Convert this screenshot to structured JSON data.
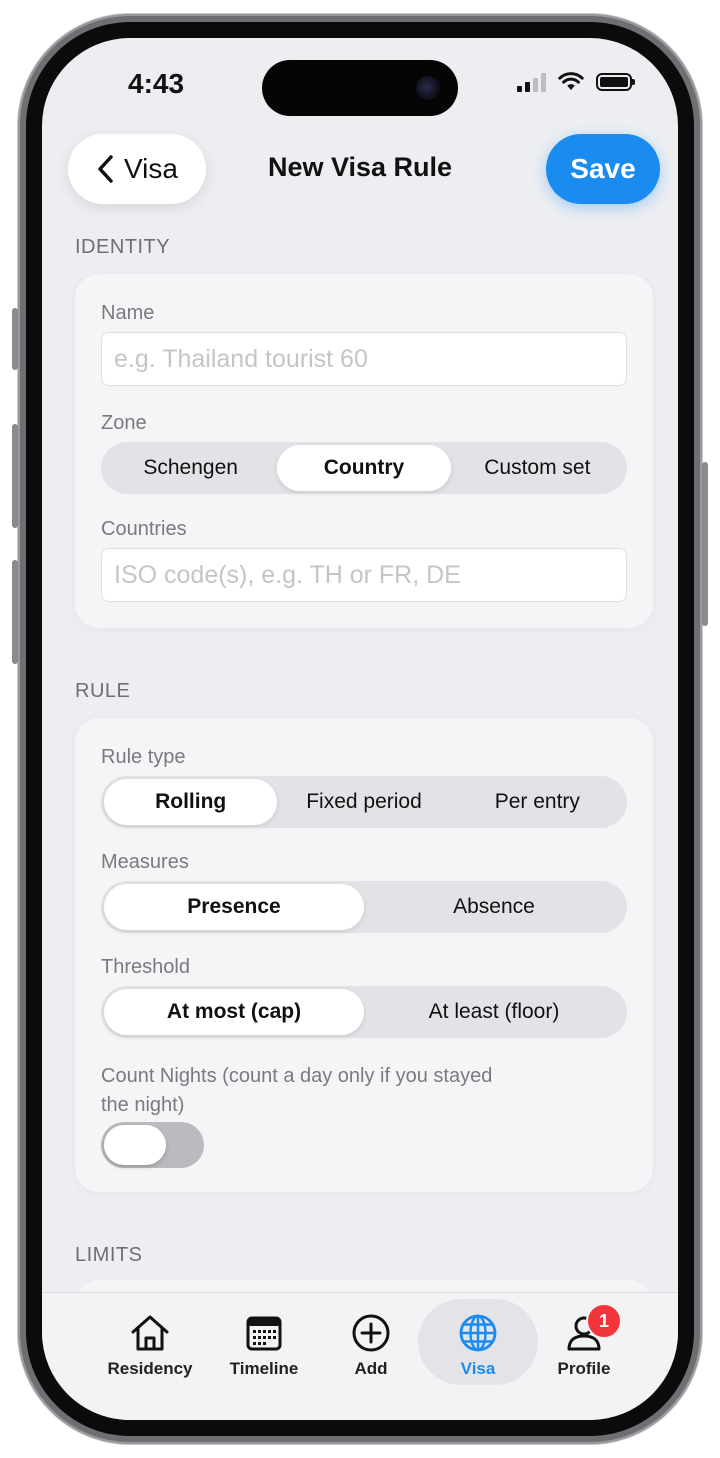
{
  "status_bar": {
    "time": "4:43"
  },
  "nav": {
    "back_label": "Visa",
    "title": "New Visa Rule",
    "save_label": "Save"
  },
  "identity": {
    "header": "IDENTITY",
    "name_label": "Name",
    "name_placeholder": "e.g. Thailand tourist 60",
    "zone_label": "Zone",
    "zone_options": [
      "Schengen",
      "Country",
      "Custom set"
    ],
    "zone_selected": "Country",
    "countries_label": "Countries",
    "countries_placeholder": "ISO code(s), e.g. TH or FR, DE"
  },
  "rule": {
    "header": "RULE",
    "rule_type_label": "Rule type",
    "rule_type_options": [
      "Rolling",
      "Fixed period",
      "Per entry"
    ],
    "rule_type_selected": "Rolling",
    "measures_label": "Measures",
    "measures_options": [
      "Presence",
      "Absence"
    ],
    "measures_selected": "Presence",
    "threshold_label": "Threshold",
    "threshold_options": [
      "At most (cap)",
      "At least (floor)"
    ],
    "threshold_selected": "At most (cap)",
    "count_nights_label_line1": "Count Nights (count a day only if you stayed",
    "count_nights_label_line2": "the night)",
    "count_nights_on": false
  },
  "limits": {
    "header": "LIMITS"
  },
  "tab_bar": {
    "tabs": [
      {
        "label": "Residency",
        "icon": "house-icon"
      },
      {
        "label": "Timeline",
        "icon": "calendar-icon"
      },
      {
        "label": "Add",
        "icon": "plus-circle-icon"
      },
      {
        "label": "Visa",
        "icon": "globe-icon"
      },
      {
        "label": "Profile",
        "icon": "person-icon"
      }
    ],
    "active": "Visa",
    "profile_badge": "1"
  },
  "colors": {
    "accent": "#1a8cf0",
    "badge": "#f2353a"
  }
}
